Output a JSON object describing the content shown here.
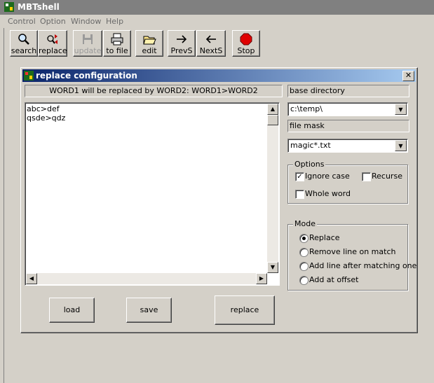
{
  "app": {
    "title": "MBTshell"
  },
  "menu": [
    "Control",
    "Option",
    "Window",
    "Help"
  ],
  "toolbar": [
    {
      "label": "search",
      "icon": "magnifier-icon"
    },
    {
      "label": "replace",
      "icon": "replace-icon"
    },
    {
      "label": "update",
      "icon": "floppy-icon",
      "disabled": true
    },
    {
      "label": "to file",
      "icon": "printer-icon"
    },
    {
      "label": "edit",
      "icon": "open-folder-icon"
    },
    {
      "label": "PrevS",
      "icon": "arrow-right-icon"
    },
    {
      "label": "NextS",
      "icon": "arrow-left-icon"
    },
    {
      "label": "Stop",
      "icon": "stop-icon"
    }
  ],
  "dialog": {
    "title": "replace configuration",
    "close_label": "✕",
    "hint": "WORD1 will be replaced by WORD2: WORD1>WORD2",
    "lines": [
      "abc>def",
      "qsde>qdz"
    ],
    "base_directory_label": "base directory",
    "base_directory_value": "c:\\temp\\",
    "file_mask_label": "file mask",
    "file_mask_value": "magic*.txt",
    "options": {
      "legend": "Options",
      "ignore_case": {
        "label": "Ignore case",
        "checked": true
      },
      "recurse": {
        "label": "Recurse",
        "checked": false
      },
      "whole_word": {
        "label": "Whole word",
        "checked": false
      }
    },
    "mode": {
      "legend": "Mode",
      "items": [
        {
          "label": "Replace",
          "selected": true
        },
        {
          "label": "Remove line on match",
          "selected": false
        },
        {
          "label": "Add line after matching one",
          "selected": false
        },
        {
          "label": "Add at offset",
          "selected": false
        }
      ]
    },
    "buttons": {
      "load": "load",
      "save": "save",
      "replace": "replace"
    }
  },
  "colors": {
    "title_active": "#0a246a",
    "title_inactive": "#808080",
    "face": "#d4d0c8"
  }
}
